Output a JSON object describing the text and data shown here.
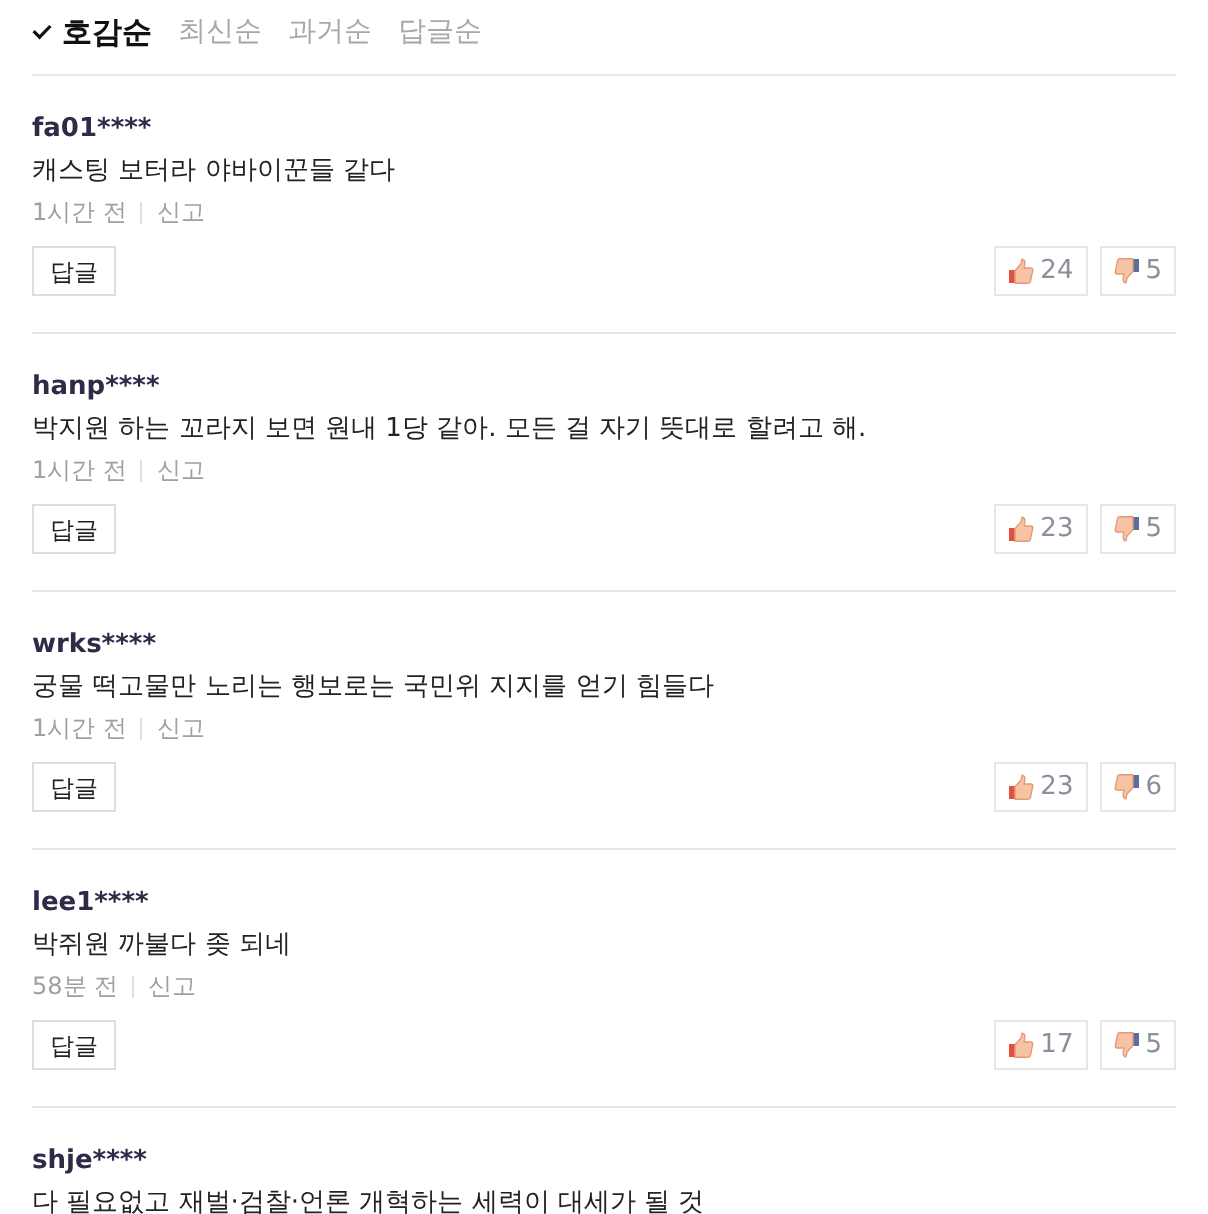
{
  "sort_tabs": [
    {
      "label": "호감순",
      "selected": true
    },
    {
      "label": "최신순",
      "selected": false
    },
    {
      "label": "과거순",
      "selected": false
    },
    {
      "label": "답글순",
      "selected": false
    }
  ],
  "comments": [
    {
      "user": "fa01****",
      "text": "캐스팅 보터라 야바이꾼들 같다",
      "time": "1시간 전",
      "report": "신고",
      "reply_button": "답글",
      "likes": "24",
      "dislikes": "5"
    },
    {
      "user": "hanp****",
      "text": "박지원 하는 꼬라지 보면 원내 1당 같아. 모든 걸 자기 뜻대로 할려고 해.",
      "time": "1시간 전",
      "report": "신고",
      "reply_button": "답글",
      "likes": "23",
      "dislikes": "5"
    },
    {
      "user": "wrks****",
      "text": "궁물 떡고물만 노리는 행보로는 국민위 지지를 얻기 힘들다",
      "time": "1시간 전",
      "report": "신고",
      "reply_button": "답글",
      "likes": "23",
      "dislikes": "6"
    },
    {
      "user": "lee1****",
      "text": "박쥐원 까불다 좆 되네",
      "time": "58분 전",
      "report": "신고",
      "reply_button": "답글",
      "likes": "17",
      "dislikes": "5"
    },
    {
      "user": "shje****",
      "text": "다 필요없고 재벌·검찰·언론 개혁하는 세력이 대세가 될 것"
    }
  ]
}
